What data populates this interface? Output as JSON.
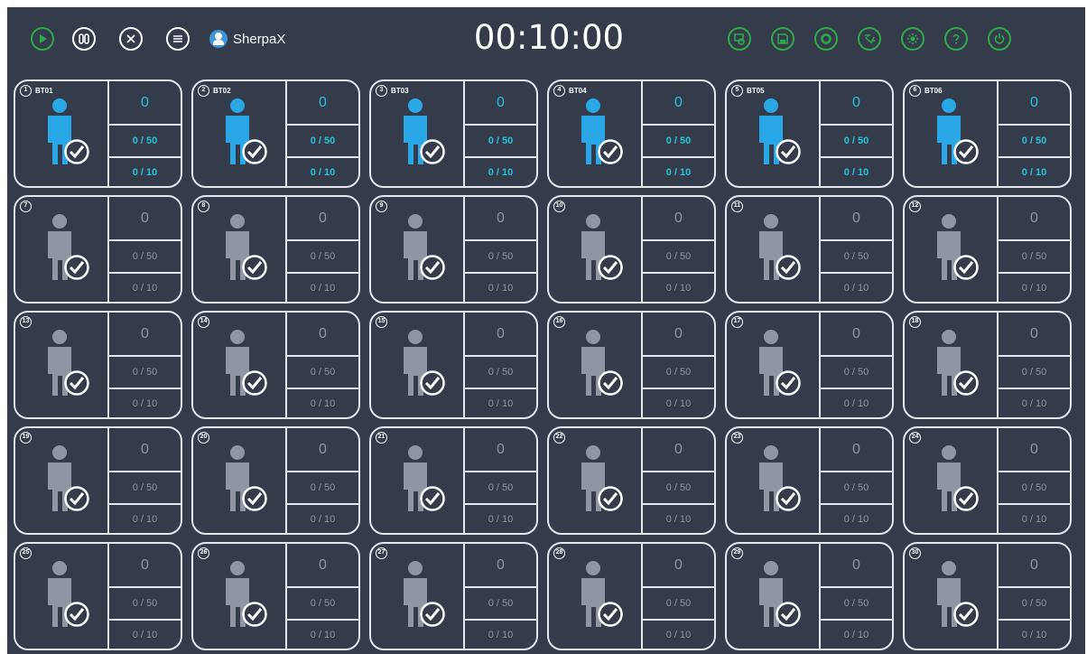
{
  "toolbar": {
    "brand": "SherpaX",
    "timer": "00:10:00",
    "left_buttons": [
      "play-icon",
      "pause-icon",
      "close-icon",
      "menu-icon"
    ],
    "right_buttons": [
      "device-icon",
      "save-icon",
      "refresh-icon",
      "language-icon",
      "settings-icon",
      "help-icon",
      "power-icon"
    ]
  },
  "colors": {
    "background": "#343c4b",
    "active_person": "#2aa7e6",
    "active_text": "#27c3d8",
    "idle_person": "#8f96a3",
    "control_green": "#2fa84a"
  },
  "slots": [
    {
      "number": "1",
      "name": "BT01",
      "active": true,
      "count": "0",
      "progress_a": "0 / 50",
      "progress_b": "0 / 10"
    },
    {
      "number": "2",
      "name": "BT02",
      "active": true,
      "count": "0",
      "progress_a": "0 / 50",
      "progress_b": "0 / 10"
    },
    {
      "number": "3",
      "name": "BT03",
      "active": true,
      "count": "0",
      "progress_a": "0 / 50",
      "progress_b": "0 / 10"
    },
    {
      "number": "4",
      "name": "BT04",
      "active": true,
      "count": "0",
      "progress_a": "0 / 50",
      "progress_b": "0 / 10"
    },
    {
      "number": "5",
      "name": "BT05",
      "active": true,
      "count": "0",
      "progress_a": "0 / 50",
      "progress_b": "0 / 10"
    },
    {
      "number": "6",
      "name": "BT06",
      "active": true,
      "count": "0",
      "progress_a": "0 / 50",
      "progress_b": "0 / 10"
    },
    {
      "number": "7",
      "name": "",
      "active": false,
      "count": "0",
      "progress_a": "0 / 50",
      "progress_b": "0 / 10"
    },
    {
      "number": "8",
      "name": "",
      "active": false,
      "count": "0",
      "progress_a": "0 / 50",
      "progress_b": "0 / 10"
    },
    {
      "number": "9",
      "name": "",
      "active": false,
      "count": "0",
      "progress_a": "0 / 50",
      "progress_b": "0 / 10"
    },
    {
      "number": "10",
      "name": "",
      "active": false,
      "count": "0",
      "progress_a": "0 / 50",
      "progress_b": "0 / 10"
    },
    {
      "number": "11",
      "name": "",
      "active": false,
      "count": "0",
      "progress_a": "0 / 50",
      "progress_b": "0 / 10"
    },
    {
      "number": "12",
      "name": "",
      "active": false,
      "count": "0",
      "progress_a": "0 / 50",
      "progress_b": "0 / 10"
    },
    {
      "number": "13",
      "name": "",
      "active": false,
      "count": "0",
      "progress_a": "0 / 50",
      "progress_b": "0 / 10"
    },
    {
      "number": "14",
      "name": "",
      "active": false,
      "count": "0",
      "progress_a": "0 / 50",
      "progress_b": "0 / 10"
    },
    {
      "number": "15",
      "name": "",
      "active": false,
      "count": "0",
      "progress_a": "0 / 50",
      "progress_b": "0 / 10"
    },
    {
      "number": "16",
      "name": "",
      "active": false,
      "count": "0",
      "progress_a": "0 / 50",
      "progress_b": "0 / 10"
    },
    {
      "number": "17",
      "name": "",
      "active": false,
      "count": "0",
      "progress_a": "0 / 50",
      "progress_b": "0 / 10"
    },
    {
      "number": "18",
      "name": "",
      "active": false,
      "count": "0",
      "progress_a": "0 / 50",
      "progress_b": "0 / 10"
    },
    {
      "number": "19",
      "name": "",
      "active": false,
      "count": "0",
      "progress_a": "0 / 50",
      "progress_b": "0 / 10"
    },
    {
      "number": "20",
      "name": "",
      "active": false,
      "count": "0",
      "progress_a": "0 / 50",
      "progress_b": "0 / 10"
    },
    {
      "number": "21",
      "name": "",
      "active": false,
      "count": "0",
      "progress_a": "0 / 50",
      "progress_b": "0 / 10"
    },
    {
      "number": "22",
      "name": "",
      "active": false,
      "count": "0",
      "progress_a": "0 / 50",
      "progress_b": "0 / 10"
    },
    {
      "number": "23",
      "name": "",
      "active": false,
      "count": "0",
      "progress_a": "0 / 50",
      "progress_b": "0 / 10"
    },
    {
      "number": "24",
      "name": "",
      "active": false,
      "count": "0",
      "progress_a": "0 / 50",
      "progress_b": "0 / 10"
    },
    {
      "number": "25",
      "name": "",
      "active": false,
      "count": "0",
      "progress_a": "0 / 50",
      "progress_b": "0 / 10"
    },
    {
      "number": "26",
      "name": "",
      "active": false,
      "count": "0",
      "progress_a": "0 / 50",
      "progress_b": "0 / 10"
    },
    {
      "number": "27",
      "name": "",
      "active": false,
      "count": "0",
      "progress_a": "0 / 50",
      "progress_b": "0 / 10"
    },
    {
      "number": "28",
      "name": "",
      "active": false,
      "count": "0",
      "progress_a": "0 / 50",
      "progress_b": "0 / 10"
    },
    {
      "number": "29",
      "name": "",
      "active": false,
      "count": "0",
      "progress_a": "0 / 50",
      "progress_b": "0 / 10"
    },
    {
      "number": "30",
      "name": "",
      "active": false,
      "count": "0",
      "progress_a": "0 / 50",
      "progress_b": "0 / 10"
    }
  ]
}
